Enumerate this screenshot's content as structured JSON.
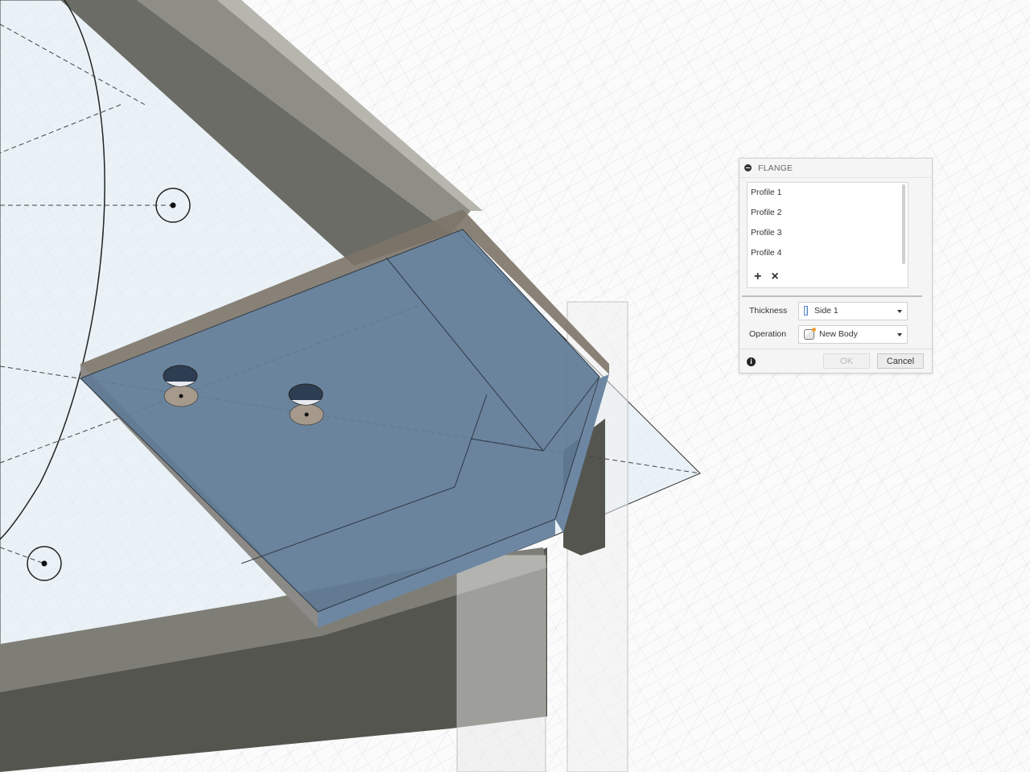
{
  "flange_dialog": {
    "title": "FLANGE",
    "profiles": [
      "Profile 1",
      "Profile 2",
      "Profile 3",
      "Profile 4"
    ],
    "add_symbol": "+",
    "remove_symbol": "×",
    "thickness": {
      "label": "Thickness",
      "value": "Side 1"
    },
    "operation": {
      "label": "Operation",
      "value": "New Body"
    },
    "ok_label": "OK",
    "cancel_label": "Cancel",
    "info_symbol": "i"
  },
  "colors": {
    "flange_fill": "#5f7b96",
    "flange_edge": "#7d7468",
    "frame_dark": "#646460",
    "grid_line": "#d8dde2",
    "sketch_plane": "#dcebf4"
  }
}
